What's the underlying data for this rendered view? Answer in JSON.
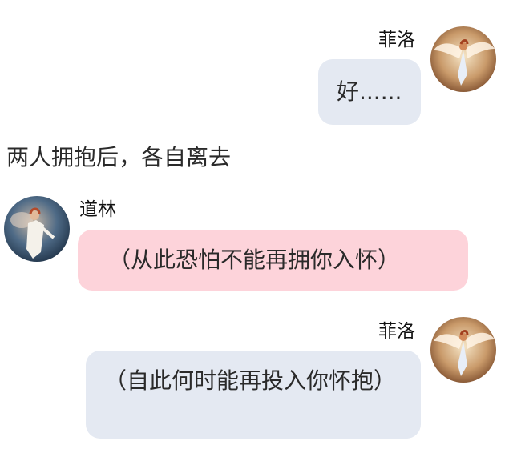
{
  "messages": [
    {
      "sender": "菲洛",
      "side": "right",
      "bubble_color": "#e4e9f2",
      "text": "好......"
    },
    {
      "type": "narration",
      "text": "两人拥抱后，各自离去"
    },
    {
      "sender": "道林",
      "side": "left",
      "bubble_color": "#fdd3da",
      "text": "（从此恐怕不能再拥你入怀）"
    },
    {
      "sender": "菲洛",
      "side": "right",
      "bubble_color": "#e4e9f2",
      "text": "（自此何时能再投入你怀抱）"
    }
  ],
  "colors": {
    "background": "#ffffff",
    "gray_bubble": "#e4e9f2",
    "pink_bubble": "#fdd3da",
    "name_text": "#111111",
    "body_text": "#2a2a2a"
  },
  "icons": {
    "feiluo_avatar": "winged-angel-avatar-icon",
    "daolin_avatar": "robed-figure-avatar-icon"
  }
}
